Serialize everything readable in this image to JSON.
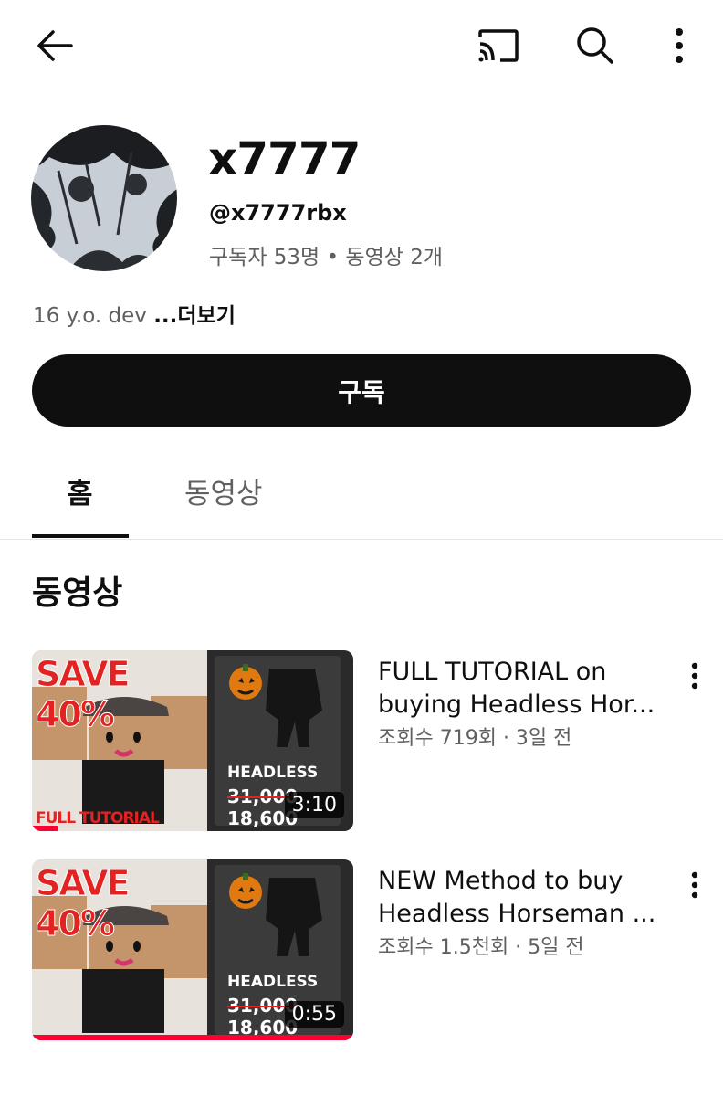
{
  "channel": {
    "name": "x7777",
    "handle": "@x7777rbx",
    "stats": "구독자 53명 • 동영상 2개",
    "description": "16 y.o. dev ",
    "more_label": "...더보기"
  },
  "subscribe_label": "구독",
  "tabs": [
    {
      "label": "홈",
      "active": true
    },
    {
      "label": "동영상",
      "active": false
    }
  ],
  "section_title": "동영상",
  "videos": [
    {
      "title_line1": "FULL TUTORIAL on",
      "title_line2": "buying Headless Hor...",
      "meta": "조회수 719회 · 3일 전",
      "duration": "3:10",
      "thumb_save": "SAVE 40%",
      "thumb_footer": "FULL TUTORIAL",
      "thumb_item": "HEADLESS",
      "thumb_old_price": "31,000",
      "thumb_new_price": "18,600",
      "watched_fraction": 0.08
    },
    {
      "title_line1": "NEW Method to buy",
      "title_line2": "Headless Horseman ...",
      "meta": "조회수 1.5천회 · 5일 전",
      "duration": "0:55",
      "thumb_save": "SAVE 40%",
      "thumb_footer": "",
      "thumb_item": "HEADLESS",
      "thumb_old_price": "31,000",
      "thumb_new_price": "18,600",
      "watched_fraction": 1.0
    }
  ],
  "icons": {
    "back": "arrow-left-icon",
    "cast": "cast-icon",
    "search": "search-icon",
    "more": "more-vertical-icon"
  },
  "colors": {
    "primary_button": "#0f0f0f",
    "progress": "#ff0033",
    "secondary_text": "#606060"
  }
}
